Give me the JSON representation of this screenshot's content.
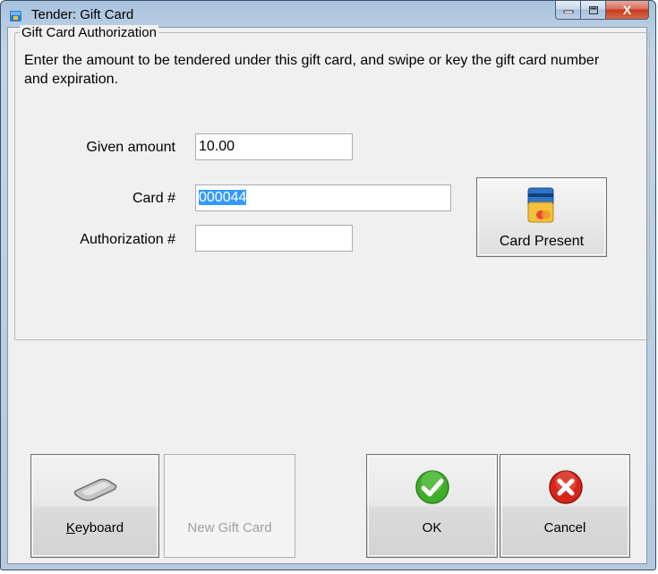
{
  "window": {
    "title": "Tender: Gift Card",
    "close_glyph": "X"
  },
  "group": {
    "legend": "Gift Card Authorization",
    "instructions": "Enter the amount to be tendered under this gift card, and swipe or key the gift card number and expiration."
  },
  "form": {
    "given_amount_label": "Given amount",
    "given_amount_value": "10.00",
    "card_label": "Card #",
    "card_value": "000044",
    "authorization_label": "Authorization #",
    "authorization_value": ""
  },
  "card_present": {
    "label": "Card Present"
  },
  "buttons": {
    "keyboard_rest": "eyboard",
    "keyboard_accel": "K",
    "new_gift_card": "New Gift Card",
    "ok": "OK",
    "cancel": "Cancel"
  },
  "colors": {
    "ok_green": "#3fae2a",
    "cancel_red": "#d5261b",
    "selection": "#3399ff"
  }
}
